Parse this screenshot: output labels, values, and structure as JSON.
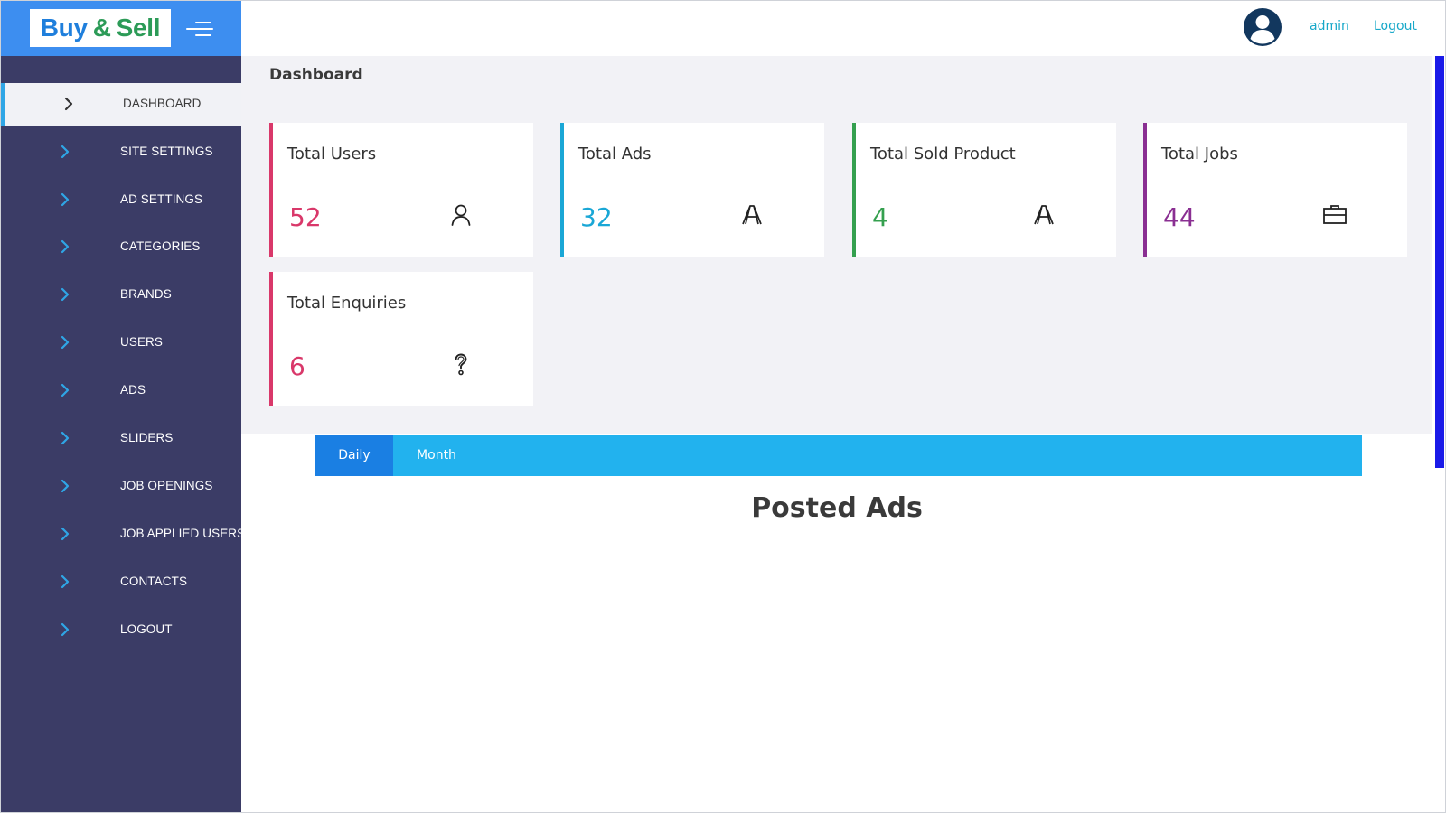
{
  "brand": {
    "buy": "Buy",
    "amp": "&",
    "sell": "Sell",
    "colors": {
      "buy": "#1f7fdc",
      "sell": "#2c9b57",
      "header": "#3d8ef0"
    }
  },
  "header": {
    "user_icon": "user-circle-icon",
    "username": "admin",
    "logout_label": "Logout"
  },
  "sidebar": {
    "background": "#3b3c66",
    "items": [
      {
        "label": "DASHBOARD",
        "active": true
      },
      {
        "label": "SITE SETTINGS"
      },
      {
        "label": "AD SETTINGS"
      },
      {
        "label": "CATEGORIES"
      },
      {
        "label": "BRANDS"
      },
      {
        "label": "USERS"
      },
      {
        "label": "ADS"
      },
      {
        "label": "SLIDERS"
      },
      {
        "label": "JOB OPENINGS"
      },
      {
        "label": "JOB APPLIED USERS"
      },
      {
        "label": "CONTACTS"
      },
      {
        "label": "LOGOUT"
      }
    ]
  },
  "main": {
    "page_title": "Dashboard",
    "cards": [
      {
        "title": "Total Users",
        "value": "52",
        "color": "#d9386a",
        "icon": "user-icon"
      },
      {
        "title": "Total Ads",
        "value": "32",
        "color": "#1aa7d6",
        "icon": "letter-a-icon"
      },
      {
        "title": "Total Sold Product",
        "value": "4",
        "color": "#35a04f",
        "icon": "letter-a-icon"
      },
      {
        "title": "Total Jobs",
        "value": "44",
        "color": "#8a2f92",
        "icon": "briefcase-icon"
      },
      {
        "title": "Total Enquiries",
        "value": "6",
        "color": "#d9386a",
        "icon": "question-mark-icon"
      }
    ],
    "tabs": [
      {
        "label": "Daily",
        "active": true
      },
      {
        "label": "Month"
      }
    ],
    "chart_title": "Posted Ads"
  }
}
